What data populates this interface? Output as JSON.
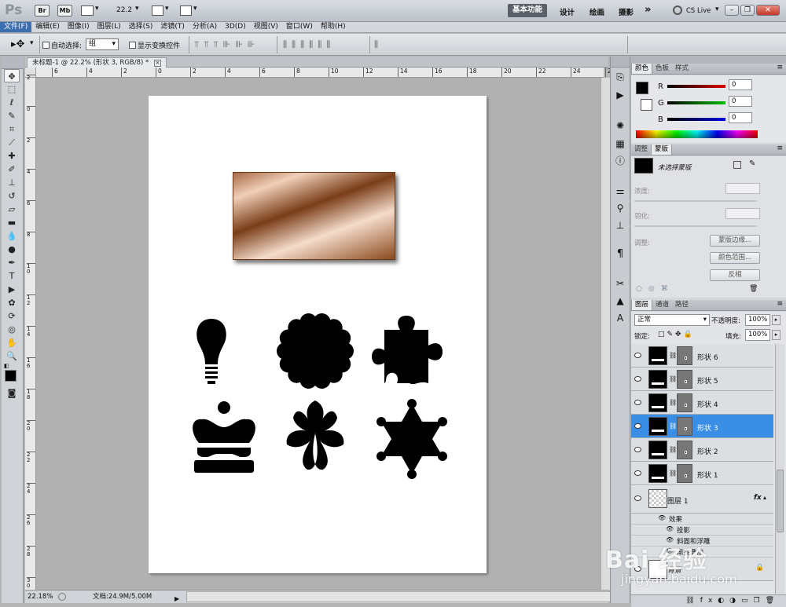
{
  "app": {
    "logo": "Ps",
    "br_label": "Br",
    "mb_label": "Mb",
    "zoom": "22.2",
    "workspaces": [
      "基本功能",
      "设计",
      "绘画",
      "摄影"
    ],
    "more": "»",
    "cs_live": "CS Live"
  },
  "menu": [
    "文件(F)",
    "编辑(E)",
    "图像(I)",
    "图层(L)",
    "选择(S)",
    "滤镜(T)",
    "分析(A)",
    "3D(D)",
    "视图(V)",
    "窗口(W)",
    "帮助(H)"
  ],
  "options": {
    "auto_select_label": "自动选择:",
    "auto_select_value": "组",
    "show_transform_label": "显示变换控件"
  },
  "document": {
    "tab_title": "未标题-1 @ 22.2% (形状 3, RGB/8) *",
    "zoom_status": "22.18%",
    "doc_size": "文档:24.9M/5.00M"
  },
  "rulers": {
    "horizontal": [
      "6",
      "4",
      "2",
      "0",
      "2",
      "4",
      "6",
      "8",
      "10",
      "12",
      "14",
      "16",
      "18",
      "20",
      "22",
      "24",
      "26",
      "28"
    ],
    "vertical": [
      "2",
      "0",
      "2",
      "4",
      "6",
      "8",
      "1\n0",
      "1\n2",
      "1\n4",
      "1\n6",
      "1\n8",
      "2\n0",
      "2\n2",
      "2\n4",
      "2\n6",
      "2\n8",
      "3\n0"
    ]
  },
  "color_panel": {
    "tabs": [
      "颜色",
      "色板",
      "样式"
    ],
    "r_label": "R",
    "g_label": "G",
    "b_label": "B",
    "r": "0",
    "g": "0",
    "b": "0"
  },
  "adjust_panel": {
    "tabs": [
      "调整",
      "蒙版"
    ],
    "no_mask": "未选择蒙版",
    "density_label": "浓度:",
    "feather_label": "羽化:",
    "refine_label": "调整:",
    "btn_mask_edge": "蒙版边缘...",
    "btn_color_range": "颜色范围...",
    "btn_invert": "反相"
  },
  "layers_panel": {
    "tabs": [
      "图层",
      "通道",
      "路径"
    ],
    "blend_mode": "正常",
    "opacity_label": "不透明度:",
    "opacity": "100%",
    "lock_label": "锁定:",
    "fill_label": "填充:",
    "fill": "100%",
    "layers": [
      {
        "name": "形状 6",
        "selected": false
      },
      {
        "name": "形状 5",
        "selected": false
      },
      {
        "name": "形状 4",
        "selected": false
      },
      {
        "name": "形状 3",
        "selected": true
      },
      {
        "name": "形状 2",
        "selected": false
      },
      {
        "name": "形状 1",
        "selected": false
      }
    ],
    "layer1_name": "图层 1",
    "fx": "fx",
    "effects_label": "效果",
    "effect_items": [
      "投影",
      "斜面和浮雕",
      "渐变叠加"
    ],
    "background_name": "背景"
  },
  "watermark": {
    "brand": "Bai 经验",
    "url": "jingyan.baidu.com"
  },
  "colors": {
    "accent": "#3a8ee6",
    "menu_highlight": "#3c6fb0",
    "gradient_dark": "#8b4a1e",
    "gradient_light": "#f2d6c2"
  }
}
